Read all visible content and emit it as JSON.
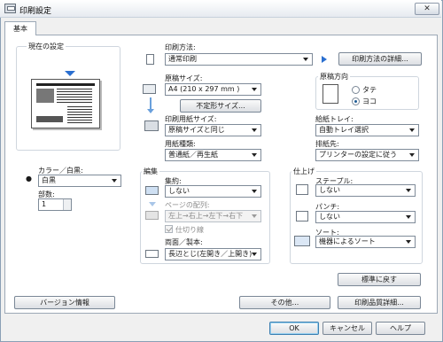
{
  "window": {
    "title": "印刷設定",
    "close_label": "✕"
  },
  "tabs": [
    {
      "label": "基本"
    }
  ],
  "current_settings": {
    "label": "現在の設定"
  },
  "print_method": {
    "label": "印刷方法:",
    "value": "通常印刷",
    "detail_button": "印刷方法の詳細..."
  },
  "paper_size": {
    "label": "原稿サイズ:",
    "value": "A4 (210 x 297 mm )",
    "custom_button": "不定形サイズ..."
  },
  "orientation": {
    "label": "原稿方向",
    "options": [
      "タテ",
      "ヨコ"
    ],
    "selected": "ヨコ"
  },
  "output_size": {
    "label": "印刷用紙サイズ:",
    "value": "原稿サイズと同じ"
  },
  "paper_type": {
    "label": "用紙種類:",
    "value": "普通紙／再生紙"
  },
  "tray": {
    "label": "給紙トレイ:",
    "value": "自動トレイ選択"
  },
  "output_dest": {
    "label": "排紙先:",
    "value": "プリンターの設定に従う"
  },
  "color": {
    "label": "カラー／白黒:",
    "value": "白黒"
  },
  "copies": {
    "label": "部数:",
    "value": "1"
  },
  "edit": {
    "label": "編集",
    "layout_label": "集約:",
    "layout_value": "しない",
    "page_order_label": "ページの配列:",
    "page_order_value": "左上→右上→左下→右下",
    "separator_label": "仕切り線",
    "duplex_label": "両面／製本:",
    "duplex_value": "長辺とじ(左開き／上開き)"
  },
  "finishing": {
    "label": "仕上げ",
    "staple_label": "ステープル:",
    "staple_value": "しない",
    "punch_label": "パンチ:",
    "punch_value": "しない",
    "sort_label": "ソート:",
    "sort_value": "機器によるソート"
  },
  "buttons": {
    "restore_defaults": "標準に戻す",
    "version": "バージョン情報",
    "other": "その他...",
    "quality": "印刷品質詳細...",
    "ok": "OK",
    "cancel": "キャンセル",
    "help": "ヘルプ"
  },
  "accent_color": "#2a6fd0"
}
